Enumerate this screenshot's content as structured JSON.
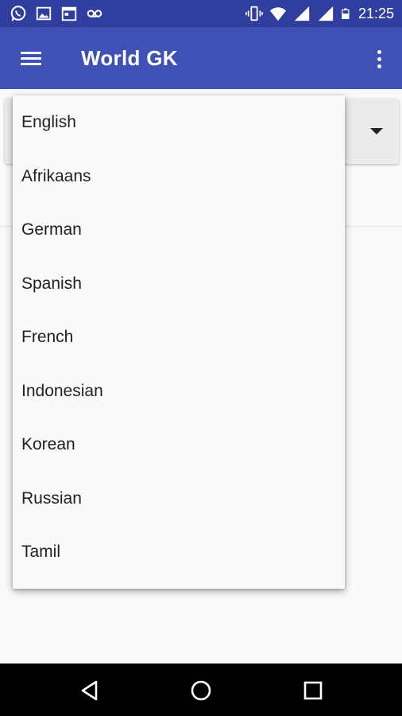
{
  "status_bar": {
    "time": "21:25",
    "left_icons": [
      "whatsapp-icon",
      "gallery-icon",
      "calendar-icon",
      "voicemail-icon"
    ],
    "right_icons": [
      "vibrate-icon",
      "wifi-icon",
      "signal-icon",
      "signal-icon",
      "battery-icon"
    ]
  },
  "app_bar": {
    "title": "World GK",
    "color": "#3F51B5",
    "status_color": "#303F9F"
  },
  "dropdown": {
    "options": [
      "English",
      "Afrikaans",
      "German",
      "Spanish",
      "French",
      "Indonesian",
      "Korean",
      "Russian",
      "Tamil"
    ]
  },
  "nav_bar": {
    "buttons": [
      "back-icon",
      "home-icon",
      "recents-icon"
    ]
  }
}
